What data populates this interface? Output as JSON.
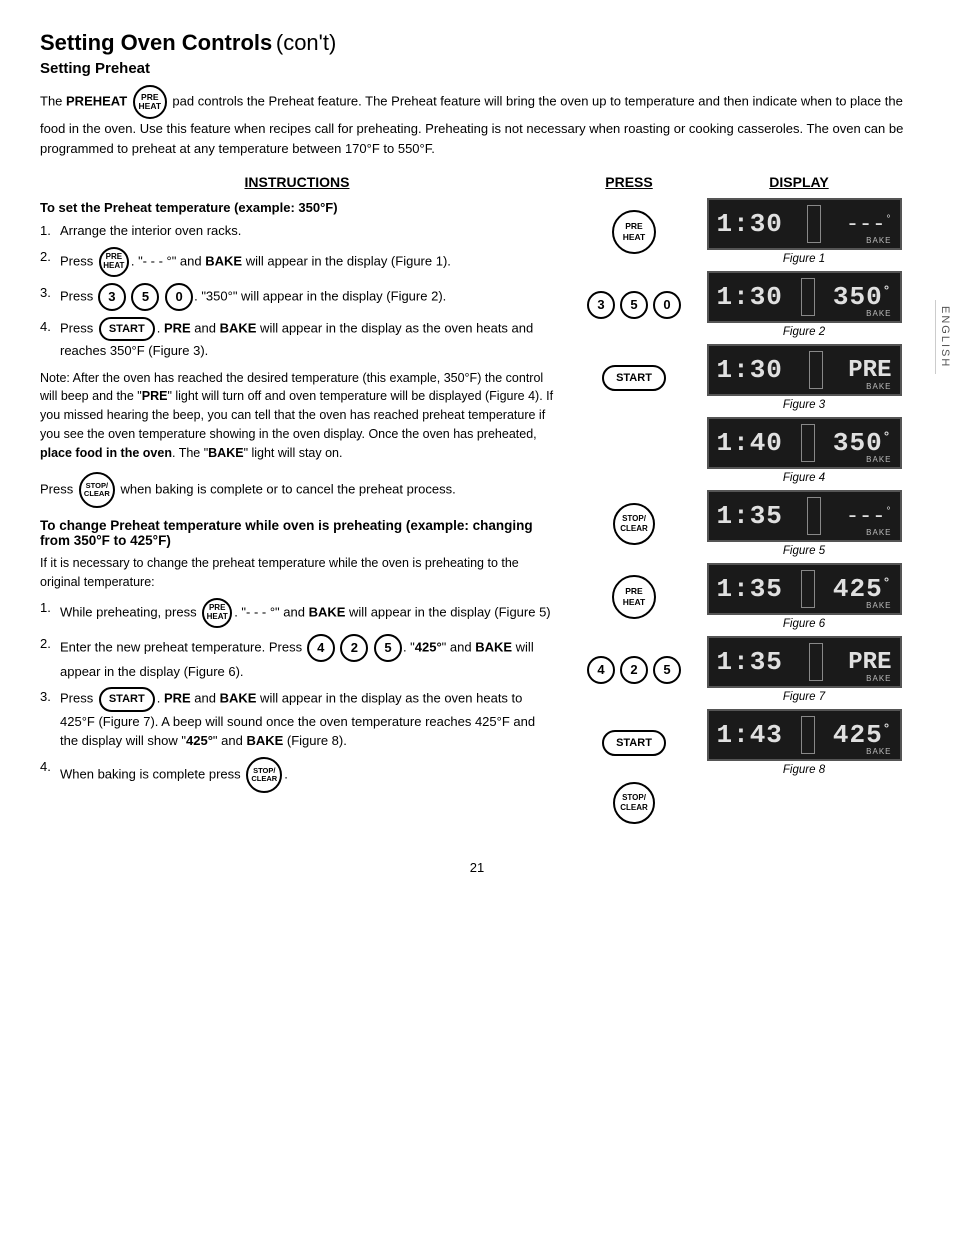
{
  "page": {
    "title": "Setting Oven Controls",
    "title_cont": "(con't)",
    "section": "Setting Preheat",
    "page_number": "21"
  },
  "intro": {
    "text1": "The ",
    "preheat_label": "PREHEAT",
    "preheat_badge": "PRE\nHEAT",
    "text2": " pad controls the Preheat feature. The Preheat feature will bring the oven up to temperature and then indicate when to place the food in the oven. Use this feature when recipes call for preheating. Preheating is not necessary when roasting or cooking casseroles. The oven can be programmed to preheat at any temperature between 170°F to 550°F."
  },
  "instructions_header": "INSTRUCTIONS",
  "press_header": "PRESS",
  "display_header": "DISPLAY",
  "set_preheat": {
    "title": "To set the Preheat temperature (example: 350°F)",
    "steps": [
      {
        "num": "1.",
        "text": "Arrange the interior oven racks."
      },
      {
        "num": "2.",
        "text": "Press PRE HEAT. \"- - - °\" and \"BAKE\" will appear in the display (Figure 1)."
      },
      {
        "num": "3.",
        "text": "Press 3 5 0. \"350°\" will appear in the display (Figure 2)."
      },
      {
        "num": "4.",
        "text": "Press START. \"PRE\" and \"BAKE\" will appear in the display as the oven heats and reaches 350°F (Figure 3)."
      }
    ],
    "note": "Note: After the oven has reached the desired temperature (this example, 350°F) the control will beep and the \"PRE\" light will turn off and oven temperature will be displayed (Figure 4). If you missed hearing the beep, you can tell that the oven has reached preheat temperature if you see the oven temperature showing in the oven display. Once the oven has preheated, place food in the oven. The \"BAKE\" light will stay on.",
    "cancel_text": "Press STOP/CLEAR when baking is complete or to cancel the preheat process."
  },
  "change_preheat": {
    "title": "To change Preheat temperature while oven is preheating (example: changing from 350°F to 425°F)",
    "sub": "If it is necessary to change the preheat temperature while the oven is preheating to the original temperature:",
    "steps": [
      {
        "num": "1.",
        "text": "While preheating, press PRE HEAT. \"- - - °\" and \"BAKE\" will appear in the display (Figure 5)"
      },
      {
        "num": "2.",
        "text": "Enter the new preheat temperature. Press 4 2 5. \"425°\" and \"BAKE\" will appear in the display (Figure 6)."
      },
      {
        "num": "3.",
        "text": "Press START. \"PRE\" and \"BAKE\" will appear in the display as the oven heats to 425°F (Figure 7). A beep will sound once the oven temperature reaches 425°F and the display will show \"425°\" and \"BAKE\" (Figure 8)."
      },
      {
        "num": "4.",
        "text": "When baking is complete press STOP/CLEAR."
      }
    ]
  },
  "figures": [
    {
      "id": 1,
      "left": "1:30",
      "right": "---°",
      "label": "Figure 1"
    },
    {
      "id": 2,
      "left": "1:30",
      "right": "350°",
      "label": "Figure 2"
    },
    {
      "id": 3,
      "left": "1:30",
      "right": "PRE",
      "label": "Figure 3"
    },
    {
      "id": 4,
      "left": "1:40",
      "right": "350°",
      "label": "Figure 4"
    },
    {
      "id": 5,
      "left": "1:35",
      "right": "---°",
      "label": "Figure 5"
    },
    {
      "id": 6,
      "left": "1:35",
      "right": "425°",
      "label": "Figure 6"
    },
    {
      "id": 7,
      "left": "1:35",
      "right": "PRE",
      "label": "Figure 7"
    },
    {
      "id": 8,
      "left": "1:43",
      "right": "425°",
      "label": "Figure 8"
    }
  ],
  "side_tab": "ENGLISH"
}
